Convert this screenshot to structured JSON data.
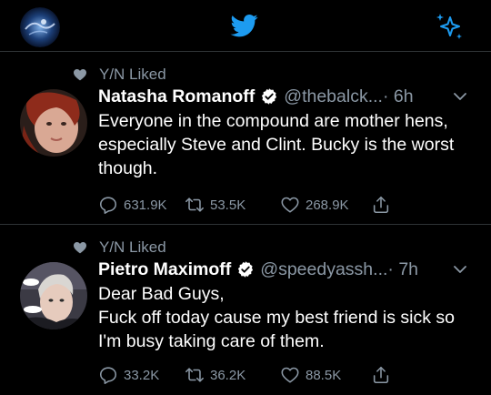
{
  "tweets": [
    {
      "context": "Y/N Liked",
      "name": "Natasha Romanoff",
      "handle": "@thebalck...",
      "time": "· 6h",
      "text": "Everyone in the compound are mother hens, especially Steve and Clint. Bucky is the worst though.",
      "replies": "631.9K",
      "retweets": "53.5K",
      "likes": "268.9K"
    },
    {
      "context": "Y/N Liked",
      "name": "Pietro Maximoff",
      "handle": "@speedyassh...",
      "time": "· 7h",
      "text": "Dear Bad Guys,\nFuck off today cause my best friend is sick so I'm busy taking care of them.",
      "replies": "33.2K",
      "retweets": "36.2K",
      "likes": "88.5K"
    }
  ],
  "colors": {
    "accent": "#1d9bf0",
    "muted": "#8b98a5",
    "background": "#000000"
  },
  "icons": [
    "twitter-bird-icon",
    "sparkle-icon",
    "heart-icon",
    "verified-badge-icon",
    "chevron-down-icon",
    "reply-icon",
    "retweet-icon",
    "like-icon",
    "share-icon"
  ]
}
